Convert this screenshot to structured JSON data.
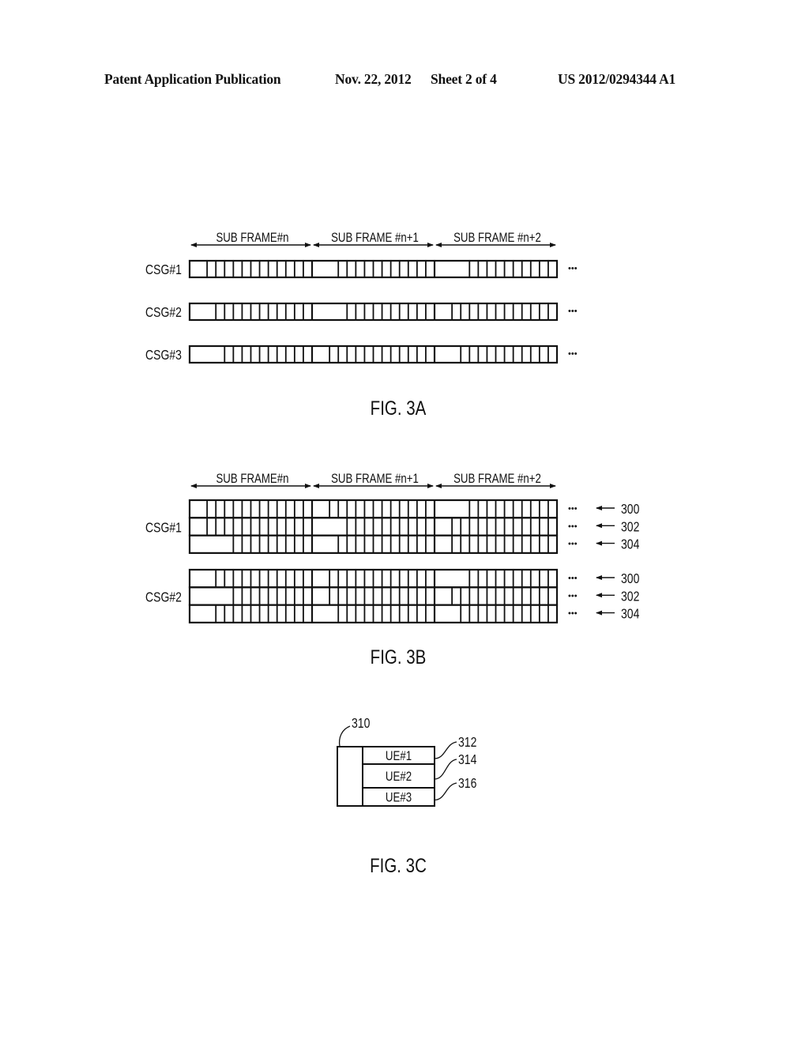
{
  "header": {
    "publication": "Patent Application Publication",
    "date": "Nov. 22, 2012",
    "sheet": "Sheet 2 of 4",
    "number": "US 2012/0294344 A1"
  },
  "slots_per_subframe": 14,
  "subframe_labels": [
    "SUB FRAME#n",
    "SUB FRAME #n+1",
    "SUB FRAME #n+2"
  ],
  "ellipsis": "•••",
  "fig3a": {
    "caption": "FIG. 3A",
    "rows": [
      {
        "label": "CSG#1",
        "control_slots": [
          2,
          3,
          4
        ]
      },
      {
        "label": "CSG#2",
        "control_slots": [
          3,
          4,
          2
        ]
      },
      {
        "label": "CSG#3",
        "control_slots": [
          4,
          2,
          3
        ]
      }
    ]
  },
  "fig3b": {
    "caption": "FIG. 3B",
    "groups": [
      {
        "label": "CSG#1",
        "rows": [
          {
            "ref": "300",
            "control_slots": [
              2,
              2,
              4
            ]
          },
          {
            "ref": "302",
            "control_slots": [
              2,
              4,
              2
            ]
          },
          {
            "ref": "304",
            "control_slots": [
              5,
              3,
              2
            ]
          }
        ]
      },
      {
        "label": "CSG#2",
        "rows": [
          {
            "ref": "300",
            "control_slots": [
              3,
              2,
              4
            ]
          },
          {
            "ref": "302",
            "control_slots": [
              5,
              2,
              2
            ]
          },
          {
            "ref": "304",
            "control_slots": [
              3,
              3,
              3
            ]
          }
        ]
      }
    ]
  },
  "fig3c": {
    "caption": "FIG. 3C",
    "ref_block": "310",
    "entries": [
      {
        "label": "UE#1",
        "ref": "312"
      },
      {
        "label": "UE#2",
        "ref": "314"
      },
      {
        "label": "UE#3",
        "ref": "316"
      }
    ]
  }
}
